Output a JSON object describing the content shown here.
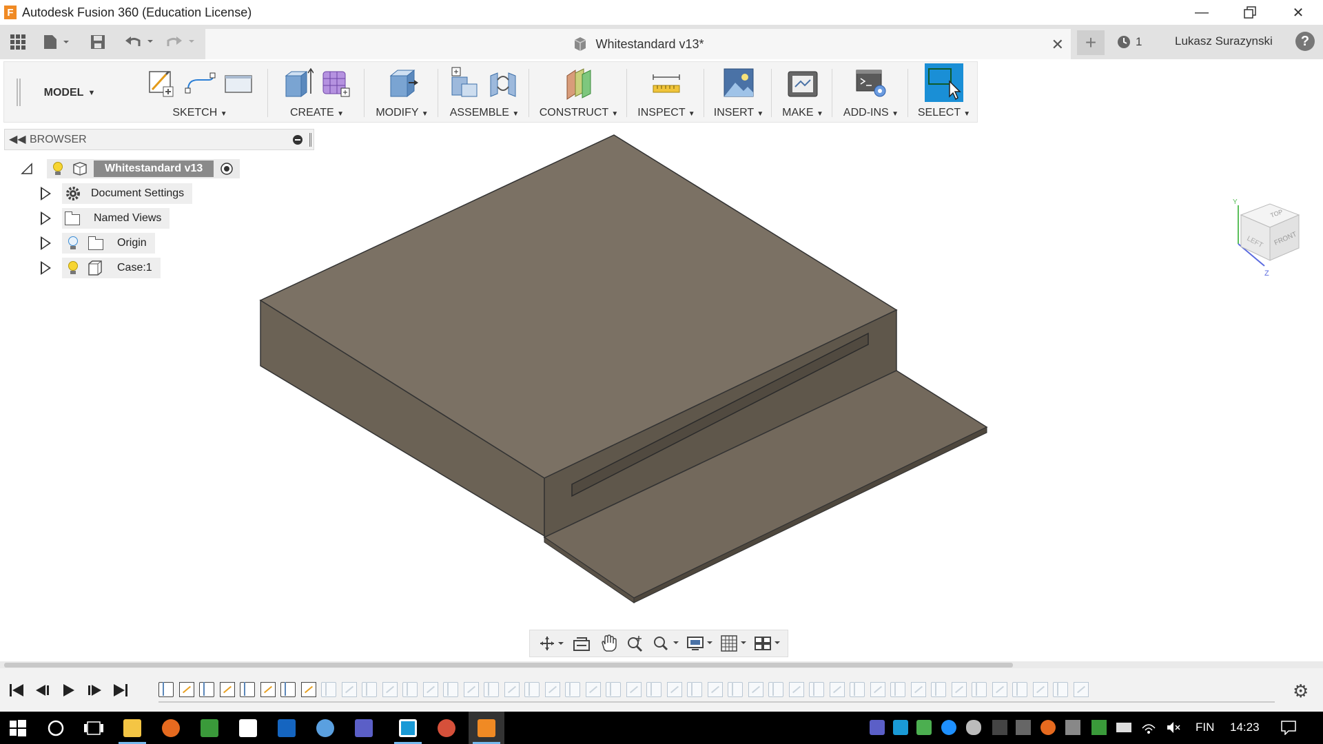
{
  "window": {
    "title": "Autodesk Fusion 360 (Education License)",
    "logo_letter": "F"
  },
  "tabbar": {
    "doc_tab_title": "Whitestandard v13*",
    "job_count": "1",
    "user_name": "Lukasz Surazynski",
    "help_glyph": "?"
  },
  "toolbar": {
    "workspace": "MODEL",
    "groups": [
      {
        "label": "SKETCH",
        "icons": [
          "create-sketch-icon",
          "line-icon",
          "rectangle-icon"
        ]
      },
      {
        "label": "CREATE",
        "icons": [
          "extrude-icon",
          "create-form-icon"
        ]
      },
      {
        "label": "MODIFY",
        "icons": [
          "press-pull-icon"
        ]
      },
      {
        "label": "ASSEMBLE",
        "icons": [
          "new-component-icon",
          "joint-icon"
        ]
      },
      {
        "label": "CONSTRUCT",
        "icons": [
          "offset-plane-icon"
        ]
      },
      {
        "label": "INSPECT",
        "icons": [
          "measure-icon"
        ]
      },
      {
        "label": "INSERT",
        "icons": [
          "insert-image-icon"
        ]
      },
      {
        "label": "MAKE",
        "icons": [
          "3d-print-icon"
        ]
      },
      {
        "label": "ADD-INS",
        "icons": [
          "scripts-addins-icon"
        ]
      },
      {
        "label": "SELECT",
        "icons": [
          "select-icon"
        ]
      }
    ]
  },
  "browser": {
    "title": "BROWSER",
    "root": "Whitestandard v13",
    "items": [
      {
        "label": "Document Settings",
        "icon": "gear-icon"
      },
      {
        "label": "Named Views",
        "icon": "folder-icon"
      },
      {
        "label": "Origin",
        "icon": "folder-icon",
        "visibility": "off"
      },
      {
        "label": "Case:1",
        "icon": "component-icon",
        "visibility": "on"
      }
    ]
  },
  "viewcube": {
    "faces": [
      "TOP",
      "FRONT",
      "LEFT"
    ],
    "axes": [
      "Y",
      "Z"
    ]
  },
  "navbar": {
    "icons": [
      "orbit-icon",
      "look-at-icon",
      "pan-icon",
      "zoom-icon",
      "fit-icon",
      "display-settings-icon",
      "grid-icon",
      "viewports-icon"
    ]
  },
  "timeline": {
    "completed_steps": 8,
    "total_steps": 46
  },
  "taskbar": {
    "apps": [
      "windows-start-icon",
      "cortana-icon",
      "task-view-icon",
      "file-explorer-icon",
      "firefox-icon",
      "notepad-icon",
      "calculator-icon",
      "outlook-icon",
      "app-icon",
      "teams-icon",
      "code-icon",
      "paint-icon",
      "fusion-360-icon"
    ],
    "language": "FIN",
    "time": "14:23"
  },
  "colors": {
    "accent": "#1a8fd6",
    "model_top": "#7b7164",
    "model_side": "#6b6255",
    "model_front": "#5f574b"
  }
}
